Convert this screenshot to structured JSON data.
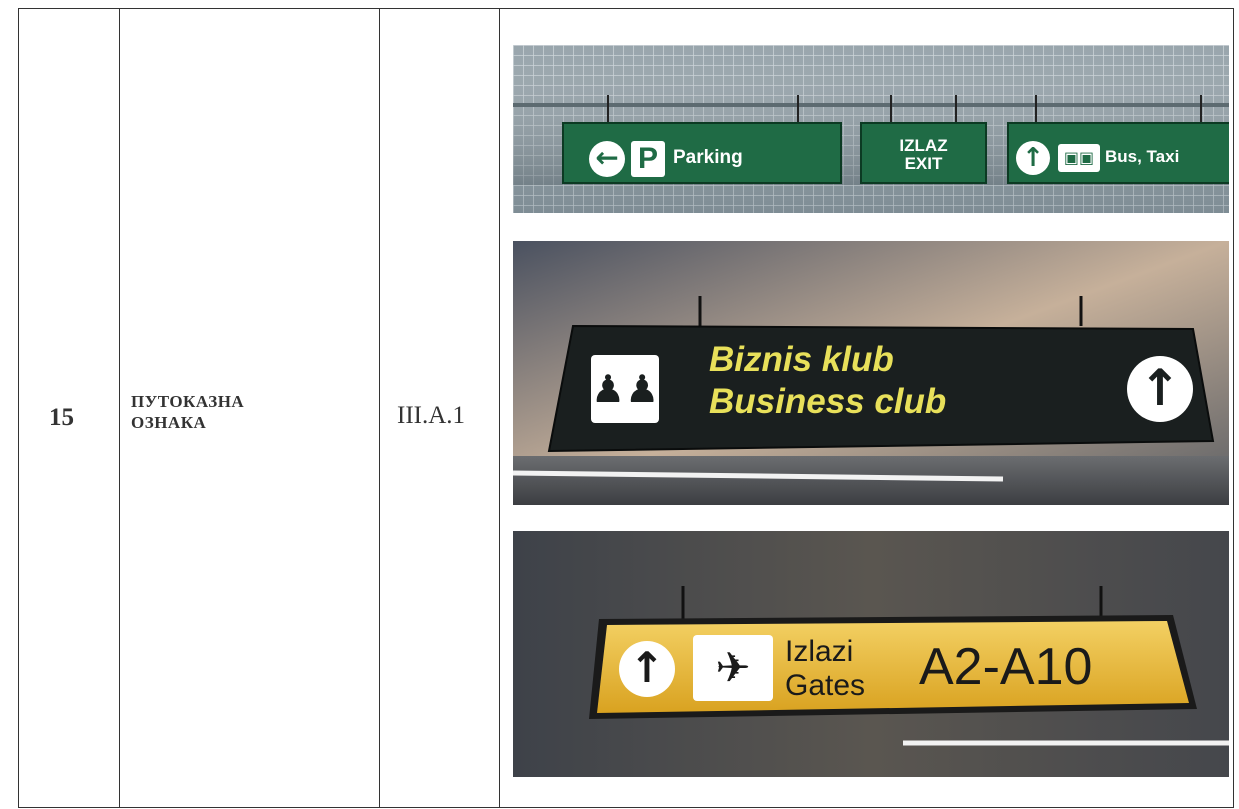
{
  "table": {
    "number": "15",
    "name_line1": "ПУТОКАЗНА",
    "name_line2": "ОЗНАКА",
    "code": "III.A.1"
  },
  "photos": {
    "sign1": {
      "parking": "Parking",
      "parking_letter": "P",
      "exit_line1": "IZLAZ",
      "exit_line2": "EXIT",
      "bus_taxi": "Bus, Taxi"
    },
    "sign2": {
      "line1": "Biznis klub",
      "line2": "Business club"
    },
    "sign3": {
      "line1": "Izlazi",
      "line2": "Gates",
      "gates": "A2-A10"
    }
  },
  "colors": {
    "sign_green": "#1f6b45",
    "sign_dark": "#1a1f1f",
    "sign_text_yellow": "#e8e05a",
    "sign_yellow": "#e9b934"
  }
}
